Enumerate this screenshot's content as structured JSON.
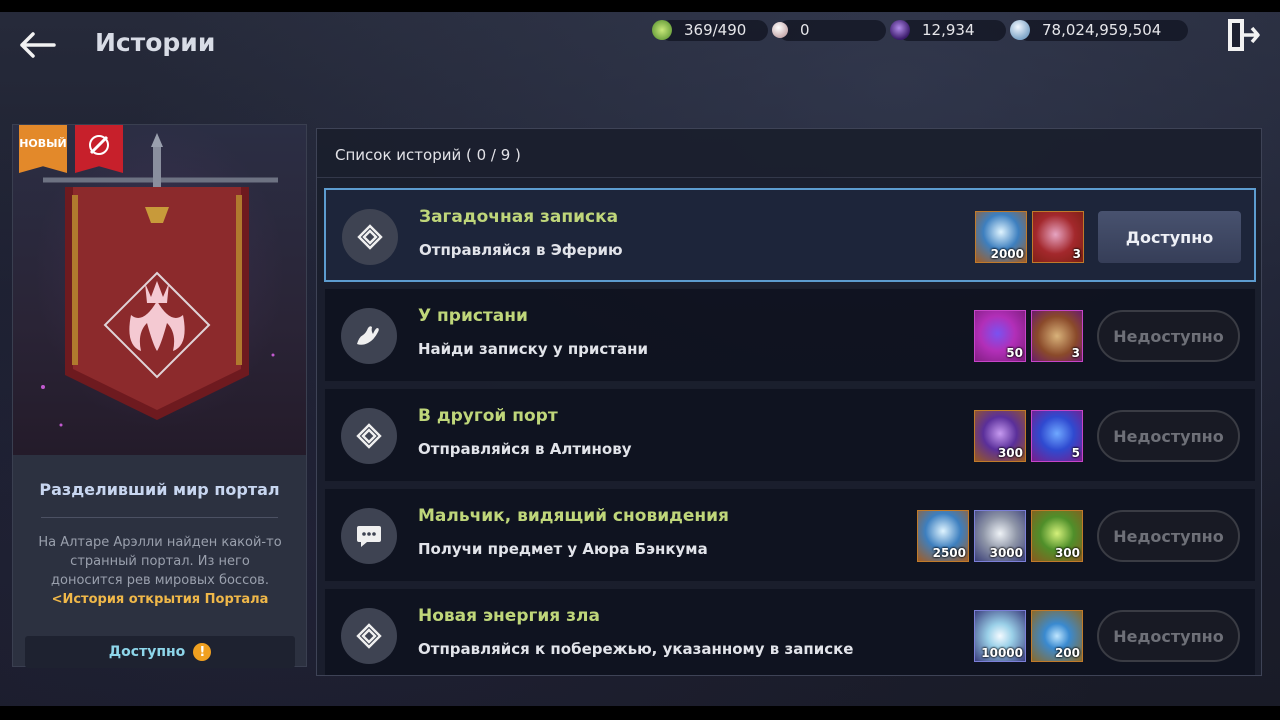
{
  "header": {
    "title": "Истории",
    "currencies": [
      {
        "icon": "energy-gem-icon",
        "value": "369/490",
        "color": "#7bc043"
      },
      {
        "icon": "pearl-icon",
        "value": "0",
        "color": "#e8d8d8"
      },
      {
        "icon": "dark-orb-icon",
        "value": "12,934",
        "color": "#6a3fb0"
      },
      {
        "icon": "silver-coin-icon",
        "value": "78,024,959,504",
        "color": "#b9cfe6"
      }
    ]
  },
  "story": {
    "badge_new": "НОВЫЙ",
    "name": "Разделивший мир портал",
    "description": "На Алтаре Арэлли найден какой-то странный портал. Из него доносится рев мировых боссов.",
    "link": "<История открытия Портала",
    "status": "Доступно",
    "status_icon": "!"
  },
  "list": {
    "header": "Список историй ( 0 / 9 )",
    "quests": [
      {
        "title": "Загадочная записка",
        "subtitle": "Отправляйся в Эферию",
        "icon": "diamond-waypoint-icon",
        "rewards": [
          {
            "name": "blue-crystal-icon",
            "count": "2000",
            "frame": "gold"
          },
          {
            "name": "treasure-chest-icon",
            "count": "3",
            "frame": "gold"
          }
        ],
        "action": "Доступно",
        "available": true
      },
      {
        "title": "У пристани",
        "subtitle": "Найди записку у пристани",
        "icon": "hand-icon",
        "rewards": [
          {
            "name": "purple-essence-icon",
            "count": "50",
            "frame": "purple"
          },
          {
            "name": "scroll-icon",
            "count": "3",
            "frame": "purple"
          }
        ],
        "action": "Недоступно",
        "available": false
      },
      {
        "title": "В другой порт",
        "subtitle": "Отправляйся в Алтинову",
        "icon": "diamond-waypoint-icon",
        "rewards": [
          {
            "name": "violet-crystal-icon",
            "count": "300",
            "frame": "gold"
          },
          {
            "name": "blue-cube-icon",
            "count": "5",
            "frame": "purple"
          }
        ],
        "action": "Недоступно",
        "available": false
      },
      {
        "title": "Мальчик, видящий сновидения",
        "subtitle": "Получи предмет у Аюра Бэнкума",
        "icon": "speech-bubble-icon",
        "rewards": [
          {
            "name": "blue-crystal-icon",
            "count": "2500",
            "frame": "gold"
          },
          {
            "name": "metal-ingot-icon",
            "count": "3000",
            "frame": "blue"
          },
          {
            "name": "green-crystal-icon",
            "count": "300",
            "frame": "gold"
          }
        ],
        "action": "Недоступно",
        "available": false
      },
      {
        "title": "Новая энергия зла",
        "subtitle": "Отправляйся к побережью, указанному в записке",
        "icon": "diamond-waypoint-icon",
        "rewards": [
          {
            "name": "white-orb-icon",
            "count": "10000",
            "frame": "blue"
          },
          {
            "name": "blue-orb-icon",
            "count": "200",
            "frame": "gold"
          }
        ],
        "action": "Недоступно",
        "available": false
      }
    ]
  }
}
